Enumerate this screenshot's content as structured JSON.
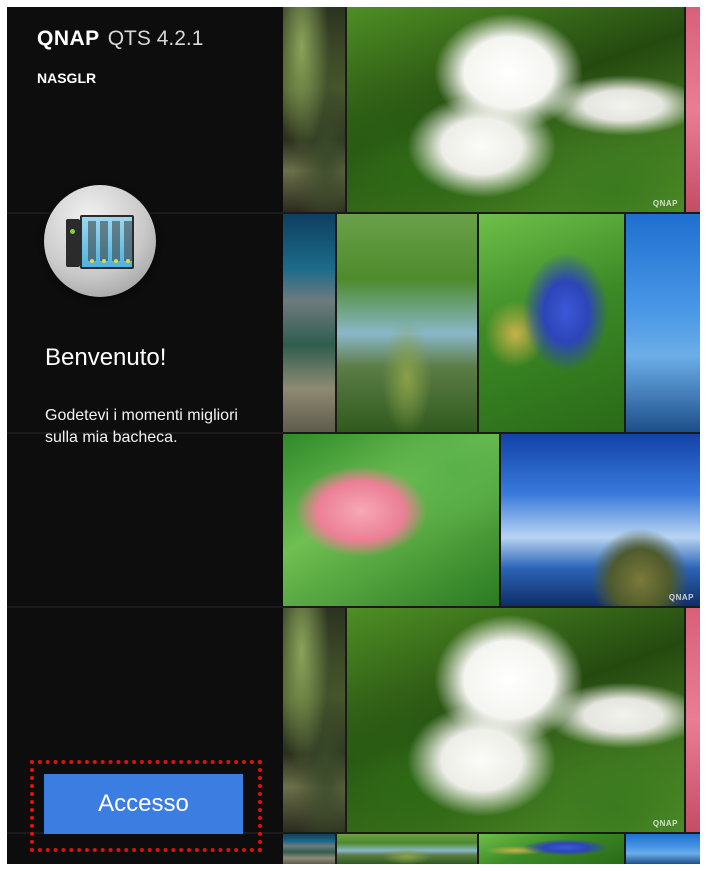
{
  "brand": {
    "logo": "QNAP",
    "version": "QTS 4.2.1"
  },
  "hostname": "NASGLR",
  "welcome": {
    "title": "Benvenuto!",
    "description": "Godetevi i momenti migliori sulla mia bacheca."
  },
  "login": {
    "label": "Accesso"
  },
  "watermark": "QNAP",
  "colors": {
    "accent": "#3b7de0",
    "highlight": "#e01010",
    "panel": "#0c0c0c"
  },
  "icons": [
    "nas-device-icon"
  ]
}
